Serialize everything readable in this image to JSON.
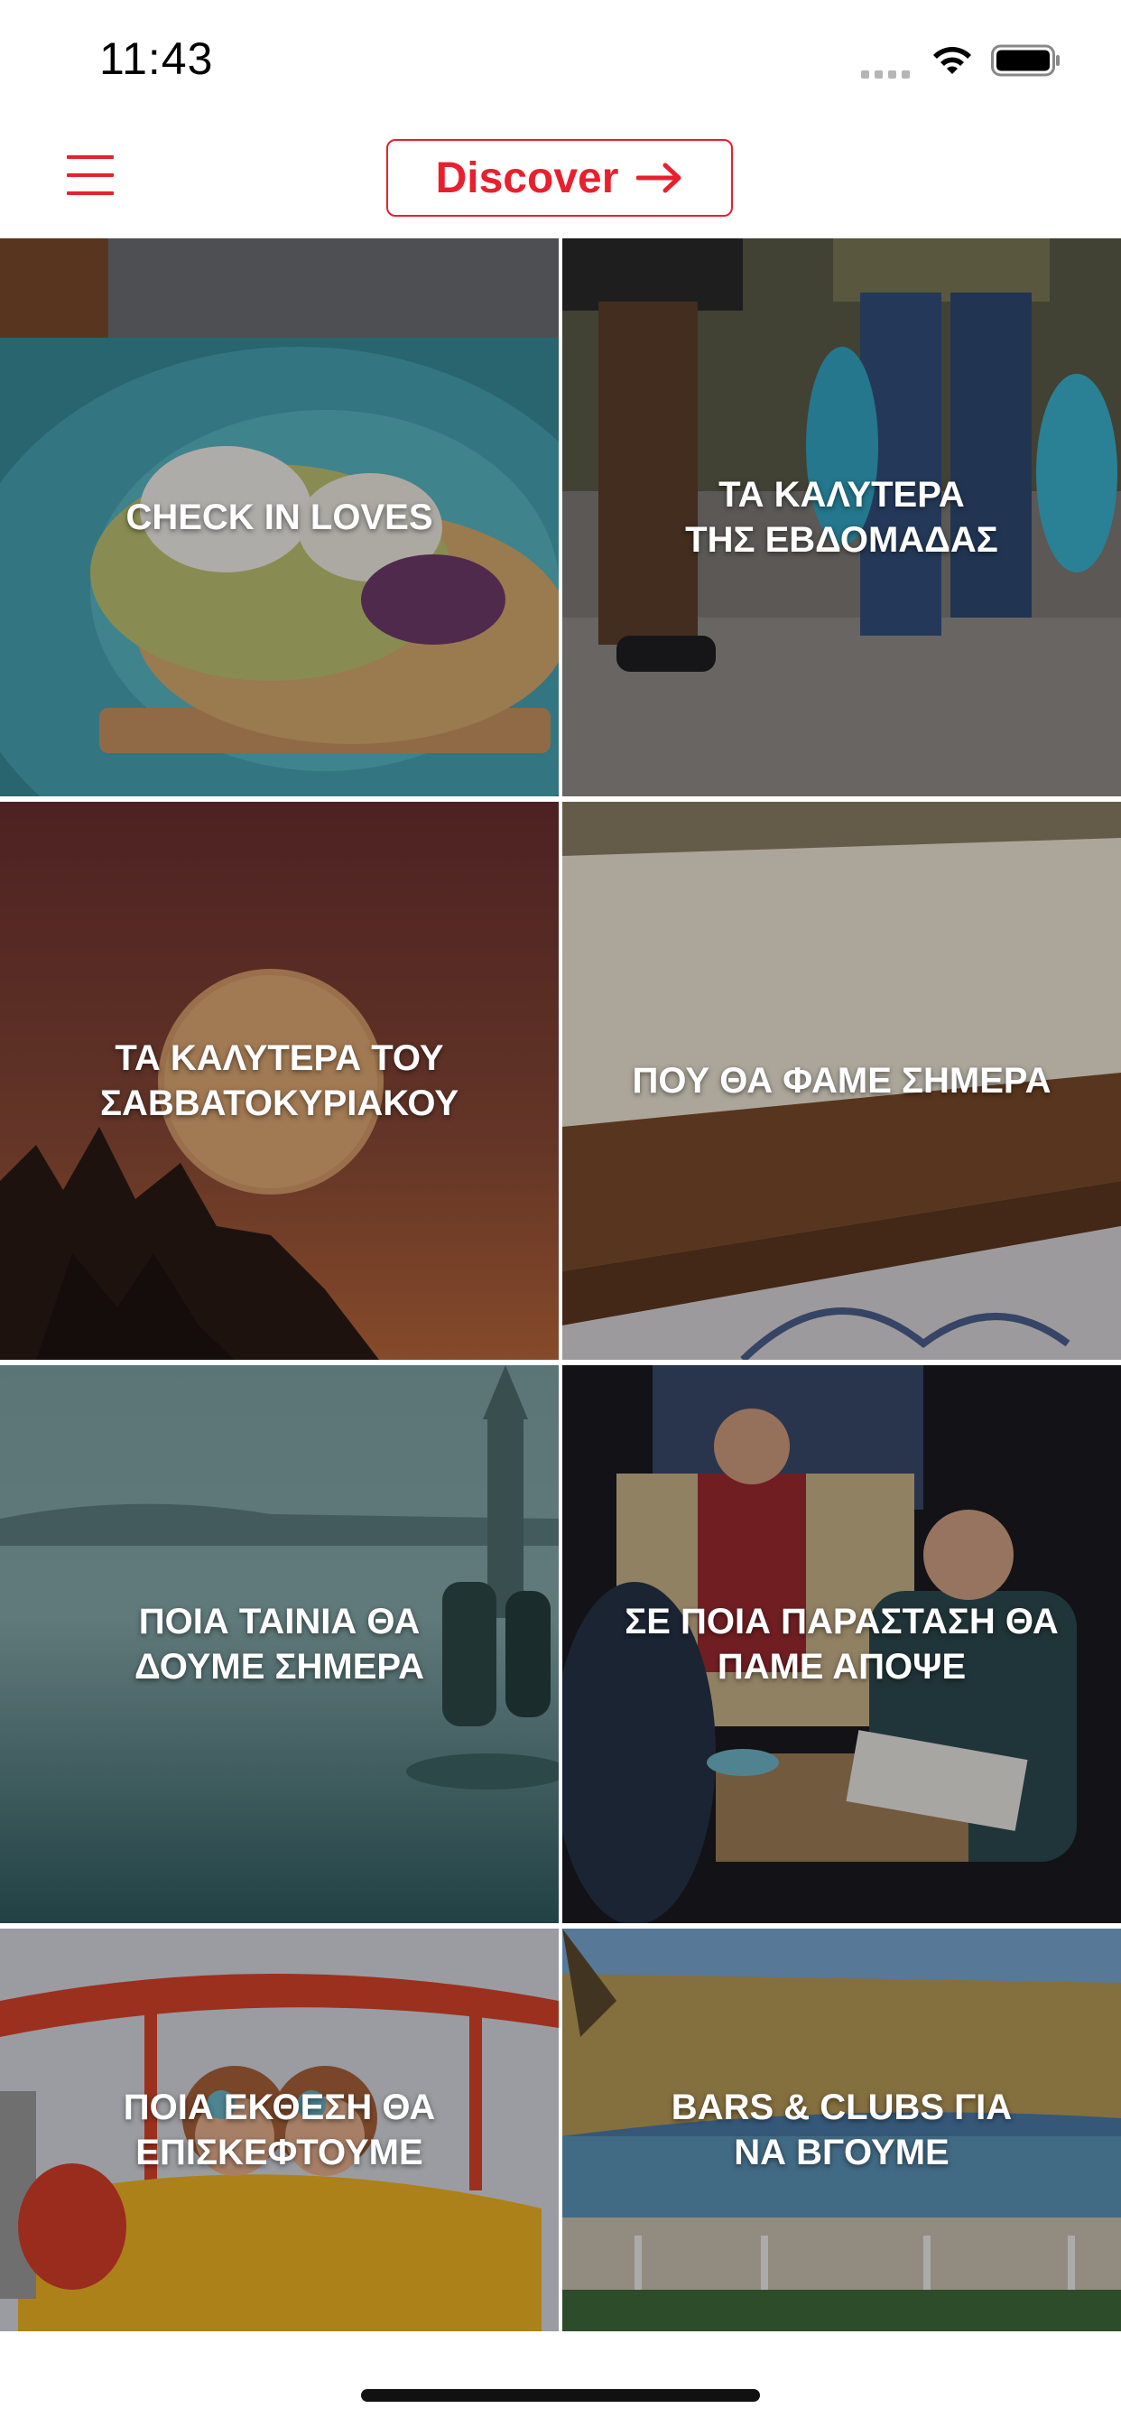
{
  "status_bar": {
    "time": "11:43",
    "icons": [
      "signal-dots-icon",
      "wifi-icon",
      "battery-icon"
    ]
  },
  "header": {
    "menu_icon": "hamburger-menu-icon",
    "discover_label": "Discover",
    "discover_icon": "arrow-right-icon"
  },
  "tiles": [
    {
      "label": "CHECK IN LOVES",
      "image": "avocado-toast-photo"
    },
    {
      "label": "ΤΑ ΚΑΛΥΤΕΡΑ\nΤΗΣ ΕΒΔΟΜΑΔΑΣ",
      "image": "people-walking-with-bags-photo"
    },
    {
      "label": "ΤΑ ΚΑΛΥΤΕΡΑ ΤΟΥ\nΣΑΒΒΑΤΟΚΥΡΙΑΚΟΥ",
      "image": "full-moon-photo"
    },
    {
      "label": "ΠΟΥ ΘΑ ΦΑΜΕ ΣΗΜΕΡΑ",
      "image": "cheesecake-photo"
    },
    {
      "label": "ΠΟΙΑ ΤΑΙΝΙΑ ΘΑ\nΔΟΥΜΕ ΣΗΜΕΡΑ",
      "image": "lake-tower-couple-photo"
    },
    {
      "label": "ΣΕ ΠΟΙΑ ΠΑΡΑΣΤΑΣΗ ΘΑ\nΠΑΜΕ ΑΠΟΨΕ",
      "image": "theater-scene-photo"
    },
    {
      "label": "ΠΟΙΑ ΕΚΘΕΣΗ ΘΑ\nΕΠΙΣΚΕΦΤΟΥΜΕ",
      "image": "cartoon-airplane-photo"
    },
    {
      "label": "BARS & CLUBS ΓΙΑ\nΝΑ ΒΓΟΥΜΕ",
      "image": "beach-bar-photo"
    }
  ],
  "colors": {
    "accent": "#e8202e",
    "background": "#ffffff",
    "tile_text": "#ffffff"
  }
}
